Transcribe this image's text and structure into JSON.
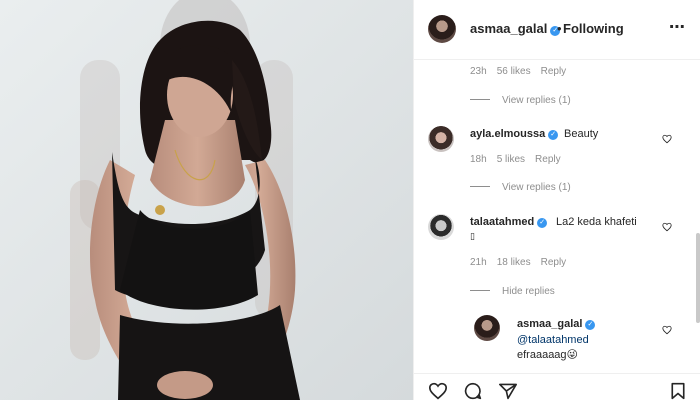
{
  "header": {
    "username": "asmaa_galal",
    "separator": "•",
    "follow_status": "Following",
    "more_icon": "more-horizontal-icon"
  },
  "comments": [
    {
      "meta": {
        "time": "23h",
        "likes": "56 likes",
        "reply": "Reply"
      },
      "view_replies": "View replies (1)"
    },
    {
      "username": "ayla.elmoussa",
      "text": "Beauty",
      "meta": {
        "time": "18h",
        "likes": "5 likes",
        "reply": "Reply"
      },
      "view_replies": "View replies (1)"
    },
    {
      "username": "talaatahmed",
      "text": "La2 keda khafeti",
      "text_line2": "▯",
      "meta": {
        "time": "21h",
        "likes": "18 likes",
        "reply": "Reply"
      },
      "view_replies": "Hide replies",
      "reply_comment": {
        "username": "asmaa_galal",
        "mention": "@talaatahmed",
        "text": "efraaaaag😜"
      }
    }
  ],
  "actions": [
    "heart-icon",
    "comment-icon",
    "share-icon",
    "bookmark-icon"
  ],
  "colors": {
    "verified": "#3897f0",
    "meta": "#8e8e8e",
    "text": "#262626"
  }
}
